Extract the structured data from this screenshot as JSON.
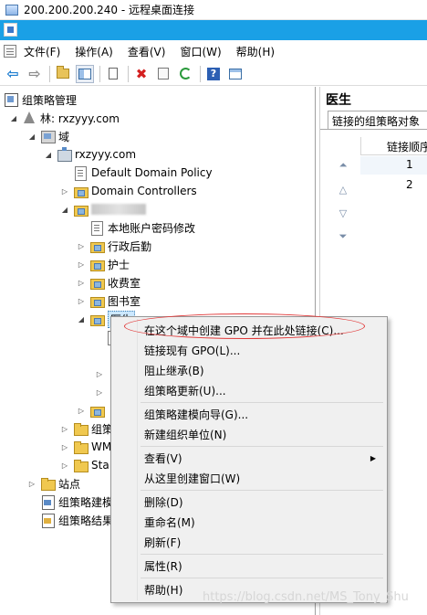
{
  "window": {
    "title": "200.200.200.240 - 远程桌面连接"
  },
  "menubar": {
    "items": [
      "文件(F)",
      "操作(A)",
      "查看(V)",
      "窗口(W)",
      "帮助(H)"
    ]
  },
  "toolbar": {
    "icons": [
      "back-arrow",
      "forward-arrow",
      "up-folder",
      "show-hide-tree",
      "clipboard",
      "delete",
      "properties",
      "refresh",
      "help",
      "new-window"
    ]
  },
  "tree": {
    "root": "组策略管理",
    "forest": "林: rxzyyy.com",
    "domains": "域",
    "domain": "rxzyyy.com",
    "default_policy": "Default Domain Policy",
    "domain_controllers": "Domain Controllers",
    "password_policy": "本地账户密码修改",
    "ou_admin": "行政后勤",
    "ou_nurse": "护士",
    "ou_cashier": "收费室",
    "ou_library": "图书室",
    "ou_doctor": "医生",
    "group_policy_partial": "组策",
    "wmi_partial": "WM",
    "starter_partial": "Sta",
    "sites": "站点",
    "modeling": "组策略建模",
    "results": "组策略结果"
  },
  "right_pane": {
    "title": "医生",
    "tab": "链接的组策略对象",
    "column": "链接顺序",
    "rows": [
      "1",
      "2"
    ]
  },
  "context_menu": {
    "items": [
      "在这个域中创建 GPO 并在此处链接(C)...",
      "链接现有 GPO(L)...",
      "阻止继承(B)",
      "组策略更新(U)...",
      "组策略建模向导(G)...",
      "新建组织单位(N)",
      "查看(V)",
      "从这里创建窗口(W)",
      "删除(D)",
      "重命名(M)",
      "刷新(F)",
      "属性(R)",
      "帮助(H)"
    ]
  },
  "watermark": "https://blog.csdn.net/MS_Tony_Shu",
  "colors": {
    "accent_strip": "#1aa0e6",
    "highlight_ellipse": "#e23a3a",
    "selection": "#cce8ff"
  }
}
